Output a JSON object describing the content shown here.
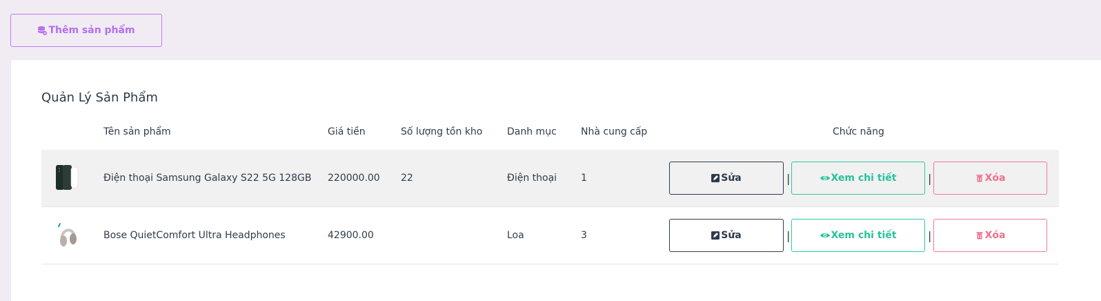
{
  "toolbar": {
    "add_label": "Thêm sản phẩm",
    "add_icon": "database-plus-icon"
  },
  "panel": {
    "title": "Quản Lý Sản Phẩm",
    "columns": {
      "name": "Tên sản phẩm",
      "price": "Giá tiền",
      "stock": "Số lượng tồn kho",
      "category": "Danh mục",
      "supplier": "Nhà cung cấp",
      "actions": "Chức năng"
    },
    "separator": "|",
    "actions": {
      "edit_label": "Sửa",
      "view_label": "Xem chi tiết",
      "delete_label": "Xóa",
      "edit_icon": "edit-icon",
      "view_icon": "eye-icon",
      "delete_icon": "trash-icon"
    },
    "rows": [
      {
        "image": "phone-thumbnail",
        "name": "Điện thoại Samsung Galaxy S22 5G 128GB",
        "price": "220000.00",
        "stock": "22",
        "category": "Điện thoại",
        "supplier": "1"
      },
      {
        "image": "headphones-thumbnail",
        "name": "Bose QuietComfort Ultra Headphones",
        "price": "42900.00",
        "stock": "",
        "category": "Loa",
        "supplier": "3"
      }
    ]
  },
  "colors": {
    "page_bg": "#f1ecf4",
    "accent_purple": "#b56ef0",
    "view_green": "#27c39a",
    "delete_pink": "#ef6f8d",
    "edit_dark": "#2e3a4a",
    "row_shade": "#f1f1f1"
  }
}
